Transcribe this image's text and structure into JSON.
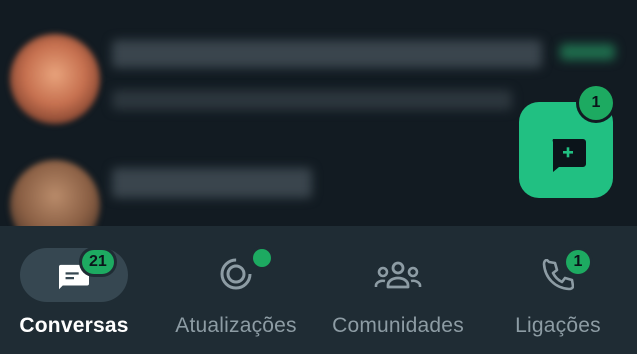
{
  "colors": {
    "accent": "#1daa61",
    "fab": "#21c082",
    "nav_bg": "#1f2c34",
    "chat_bg": "#121b22",
    "active_pill": "#364751",
    "inactive": "#8d9ca4"
  },
  "fab": {
    "icon": "new-chat-plus-icon",
    "badge": "1"
  },
  "nav": {
    "items": [
      {
        "label": "Conversas",
        "icon": "chats-icon",
        "badge": "21",
        "active": true
      },
      {
        "label": "Atualizações",
        "icon": "status-icon",
        "dot": true,
        "active": false
      },
      {
        "label": "Comunidades",
        "icon": "communities-icon",
        "active": false
      },
      {
        "label": "Ligações",
        "icon": "phone-icon",
        "badge": "1",
        "active": false
      }
    ]
  }
}
